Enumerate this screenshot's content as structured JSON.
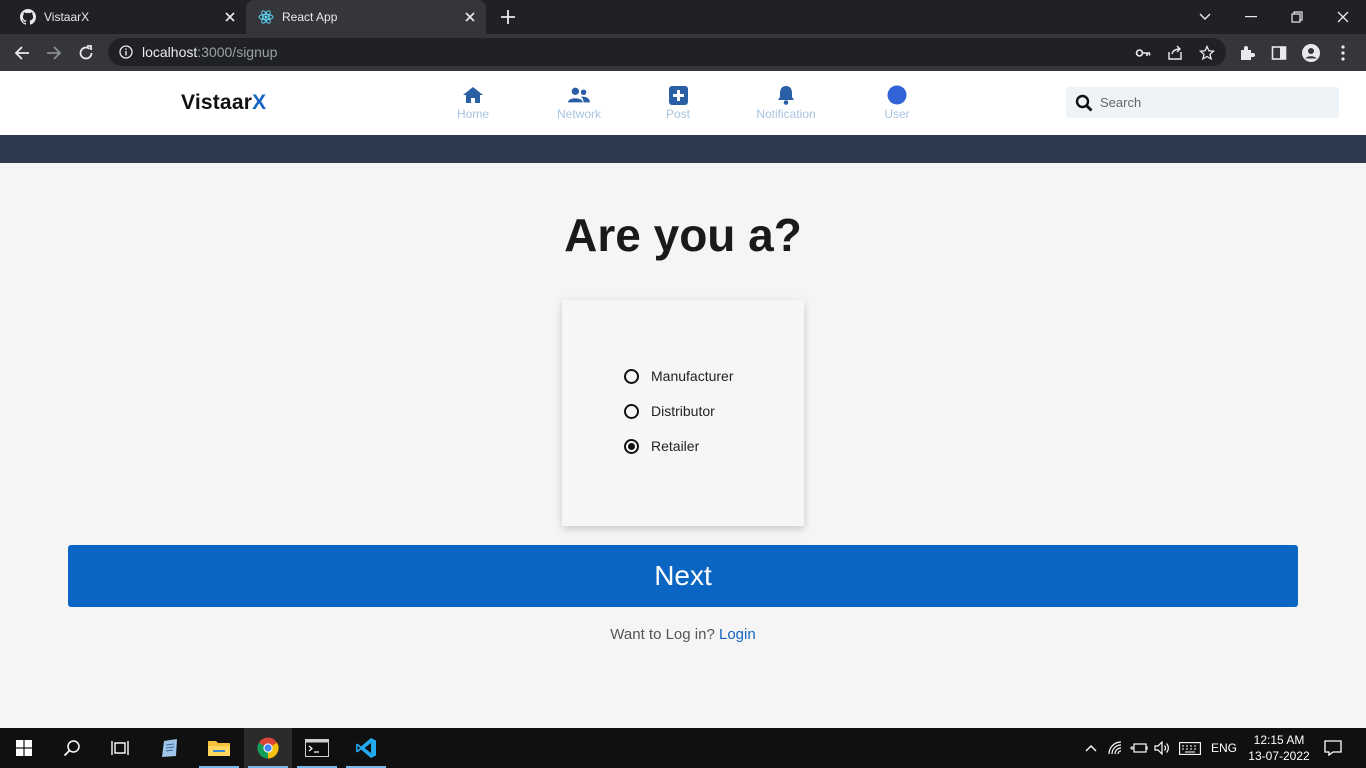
{
  "browser": {
    "tabs": [
      {
        "title": "VistaarX",
        "icon": "github-icon"
      },
      {
        "title": "React App",
        "icon": "react-icon"
      }
    ],
    "url_host": "localhost",
    "url_path": ":3000/signup"
  },
  "app": {
    "logo_main": "Vistaar",
    "logo_accent": "X",
    "nav": {
      "home": "Home",
      "network": "Network",
      "post": "Post",
      "notification": "Notification",
      "user": "User"
    },
    "search_placeholder": "Search",
    "accent_color": "#0a66c2",
    "band_color": "#2e3a50"
  },
  "signup": {
    "heading": "Are you a?",
    "options": [
      {
        "label": "Manufacturer",
        "selected": false
      },
      {
        "label": "Distributor",
        "selected": false
      },
      {
        "label": "Retailer",
        "selected": true
      }
    ],
    "next_label": "Next",
    "login_prompt": "Want to Log in?",
    "login_link": "Login"
  },
  "taskbar": {
    "language": "ENG",
    "time": "12:15 AM",
    "date": "13-07-2022"
  }
}
